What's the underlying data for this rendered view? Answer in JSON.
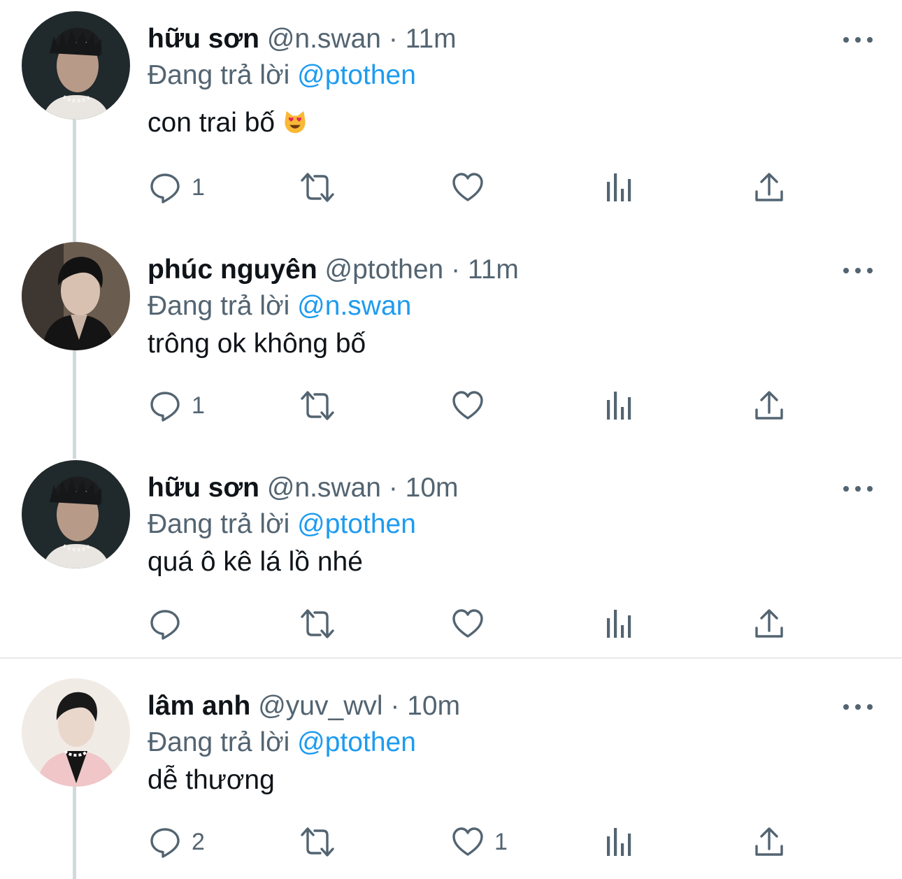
{
  "theme": {
    "mention_color": "#1d9bf0",
    "muted_color": "#536471",
    "thread_line_color": "#cfd9de"
  },
  "tweets": [
    {
      "name": "hữu sơn",
      "handle": "@n.swan",
      "separator": "·",
      "time": "11m",
      "reply_prefix": "Đang trả lời",
      "reply_to": "@ptothen",
      "text": "con trai bố",
      "emoji": "smiling-cat-heart-eyes-emoji",
      "reply_count": "1",
      "retweet_count": "",
      "like_count": "",
      "avatar": "avatar-nswan-photo"
    },
    {
      "name": "phúc nguyên",
      "handle": "@ptothen",
      "separator": "·",
      "time": "11m",
      "reply_prefix": "Đang trả lời",
      "reply_to": "@n.swan",
      "text": "trông ok không bố",
      "reply_count": "1",
      "retweet_count": "",
      "like_count": "",
      "avatar": "avatar-ptothen-photo"
    },
    {
      "name": "hữu sơn",
      "handle": "@n.swan",
      "separator": "·",
      "time": "10m",
      "reply_prefix": "Đang trả lời",
      "reply_to": "@ptothen",
      "text": "quá ô kê lá lồ nhé",
      "reply_count": "",
      "retweet_count": "",
      "like_count": "",
      "avatar": "avatar-nswan-photo"
    },
    {
      "name": "lâm anh",
      "handle": "@yuv_wvl",
      "separator": "·",
      "time": "10m",
      "reply_prefix": "Đang trả lời",
      "reply_to": "@ptothen",
      "text": "dễ thương",
      "reply_count": "2",
      "retweet_count": "",
      "like_count": "1",
      "avatar": "avatar-yuvwvl-photo"
    }
  ],
  "icons": [
    "reply-icon",
    "retweet-icon",
    "like-icon",
    "views-icon",
    "share-icon",
    "more-icon"
  ]
}
